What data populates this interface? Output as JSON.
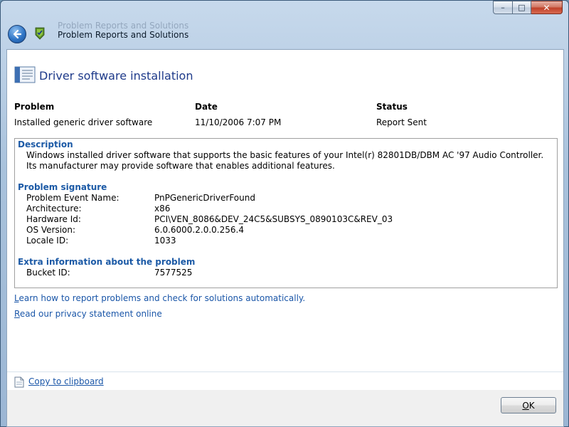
{
  "window": {
    "faded_title": "Problem Reports and Solutions",
    "title": "Problem Reports and Solutions",
    "min_glyph": "–",
    "max_glyph": "□",
    "close_glyph": "✕"
  },
  "report": {
    "heading": "Driver software installation",
    "columns": {
      "problem_label": "Problem",
      "date_label": "Date",
      "status_label": "Status",
      "problem_value": "Installed generic driver software",
      "date_value": "11/10/2006 7:07 PM",
      "status_value": "Report Sent"
    },
    "description": {
      "title": "Description",
      "text": "Windows installed driver software that supports the basic features of your Intel(r) 82801DB/DBM AC '97 Audio Controller. Its manufacturer may provide software that enables additional features."
    },
    "signature": {
      "title": "Problem signature",
      "rows": [
        {
          "label": "Problem Event Name:",
          "value": "PnPGenericDriverFound"
        },
        {
          "label": "Architecture:",
          "value": "x86"
        },
        {
          "label": "Hardware Id:",
          "value": "PCI\\VEN_8086&DEV_24C5&SUBSYS_0890103C&REV_03"
        },
        {
          "label": "OS Version:",
          "value": "6.0.6000.2.0.0.256.4"
        },
        {
          "label": "Locale ID:",
          "value": "1033"
        }
      ]
    },
    "extra": {
      "title": "Extra information about the problem",
      "rows": [
        {
          "label": "Bucket ID:",
          "value": "7577525"
        }
      ]
    }
  },
  "links": {
    "learn_first": "L",
    "learn_rest": "earn how to report problems and check for solutions automatically.",
    "privacy_first": "R",
    "privacy_rest": "ead our privacy statement online"
  },
  "footer": {
    "copy_label": "Copy to clipboard"
  },
  "buttons": {
    "ok_first": "O",
    "ok_rest": "K"
  }
}
